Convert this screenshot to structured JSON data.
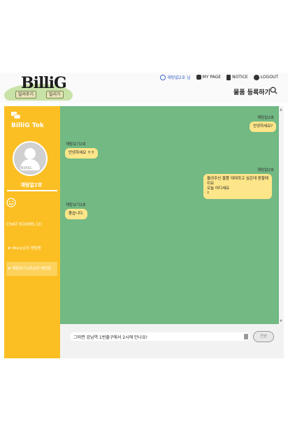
{
  "logo": {
    "text": "BilliG",
    "btn1": "빌려주기",
    "btn2": "빌리기"
  },
  "topnav": {
    "user": "재탕없2호 님",
    "mypage": "MY PAGE",
    "notice": "NOTICE",
    "logout": "LOGOUT"
  },
  "header": {
    "register": "물품 등록하기"
  },
  "sidebar": {
    "brand": "BilliG Tok",
    "avatar_tag": "B|ill|G",
    "username": "재탕없2호",
    "rooms_title": "CHAT ROOMS (2)",
    "rooms": [
      "# Misty님의 채팅방",
      "# 재탕보기2호님의 채팅방"
    ]
  },
  "messages": [
    {
      "sender": "재탕없2호",
      "text": "안녕하세요?",
      "side": "right"
    },
    {
      "sender": "재탕보기2호",
      "text": "안녕하세요 ㅎㅎ",
      "side": "left"
    },
    {
      "sender": "재탕없2호",
      "text": "올려주신 물품 대여하고 싶은데 편할때이요\n오늘 어디세요\n?",
      "side": "right"
    },
    {
      "sender": "재탕보기2호",
      "text": "좋습니다.",
      "side": "left"
    }
  ],
  "input": {
    "value": "그러면 강남역 1번출구에서 2시에 만나요!"
  },
  "send": {
    "label": "전송"
  },
  "colors": {
    "sidebar": "#fbbf24",
    "chat_bg": "#72b984",
    "bubble": "#fde68a"
  }
}
